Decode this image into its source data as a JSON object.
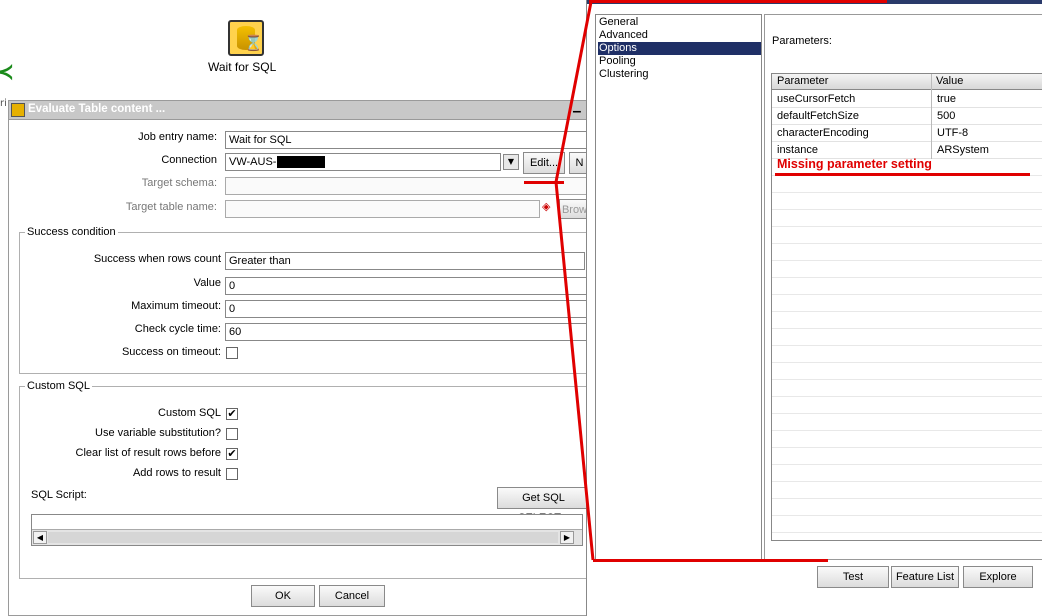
{
  "canvas": {
    "job_label": "Wait for SQL"
  },
  "dialog": {
    "title": "Evaluate Table content ...",
    "fields": {
      "job_entry_name": {
        "label": "Job entry name:",
        "value": "Wait for SQL"
      },
      "connection": {
        "label": "Connection",
        "value": "VW-AUS-"
      },
      "target_schema": {
        "label": "Target schema:",
        "value": ""
      },
      "target_table": {
        "label": "Target table name:",
        "value": ""
      }
    },
    "buttons": {
      "edit": "Edit...",
      "new": "N",
      "browse": "Brow",
      "get_sql": "Get SQL SELECT...",
      "ok": "OK",
      "cancel": "Cancel"
    },
    "success_group": {
      "legend": "Success condition",
      "rows_count_label": "Success when rows count",
      "rows_count_value": "Greater than",
      "value_label": "Value",
      "value": "0",
      "max_timeout_label": "Maximum timeout:",
      "max_timeout_value": "0",
      "check_cycle_label": "Check cycle time:",
      "check_cycle_value": "60",
      "success_on_timeout_label": "Success on timeout:",
      "success_on_timeout_checked": false
    },
    "custom_group": {
      "legend": "Custom SQL",
      "custom_sql_label": "Custom SQL",
      "custom_sql_checked": true,
      "var_sub_label": "Use variable substitution?",
      "var_sub_checked": false,
      "clear_list_label": "Clear list of result rows before",
      "clear_list_checked": true,
      "add_rows_label": "Add rows to result",
      "add_rows_checked": false,
      "sql_script_label": "SQL Script:"
    }
  },
  "right_panel": {
    "nav": [
      "General",
      "Advanced",
      "Options",
      "Pooling",
      "Clustering"
    ],
    "nav_selected": "Options",
    "parameters_label": "Parameters:",
    "columns": [
      "Parameter",
      "Value"
    ],
    "rows": [
      {
        "param": "useCursorFetch",
        "value": "true"
      },
      {
        "param": "defaultFetchSize",
        "value": "500"
      },
      {
        "param": "characterEncoding",
        "value": "UTF-8"
      },
      {
        "param": "instance",
        "value": "ARSystem"
      }
    ],
    "annotation": "Missing parameter setting",
    "buttons": {
      "test": "Test",
      "feature_list": "Feature List",
      "explore": "Explore"
    }
  },
  "colors": {
    "annotation_red": "#e00000",
    "selection_navy": "#1f2f66"
  },
  "icons": [
    "database-wait-icon",
    "hop-icon",
    "dialog-title-icon",
    "dropdown-arrow-icon",
    "variable-diamond-icon",
    "checkmark-icon",
    "scroll-left-icon",
    "scroll-right-icon"
  ]
}
